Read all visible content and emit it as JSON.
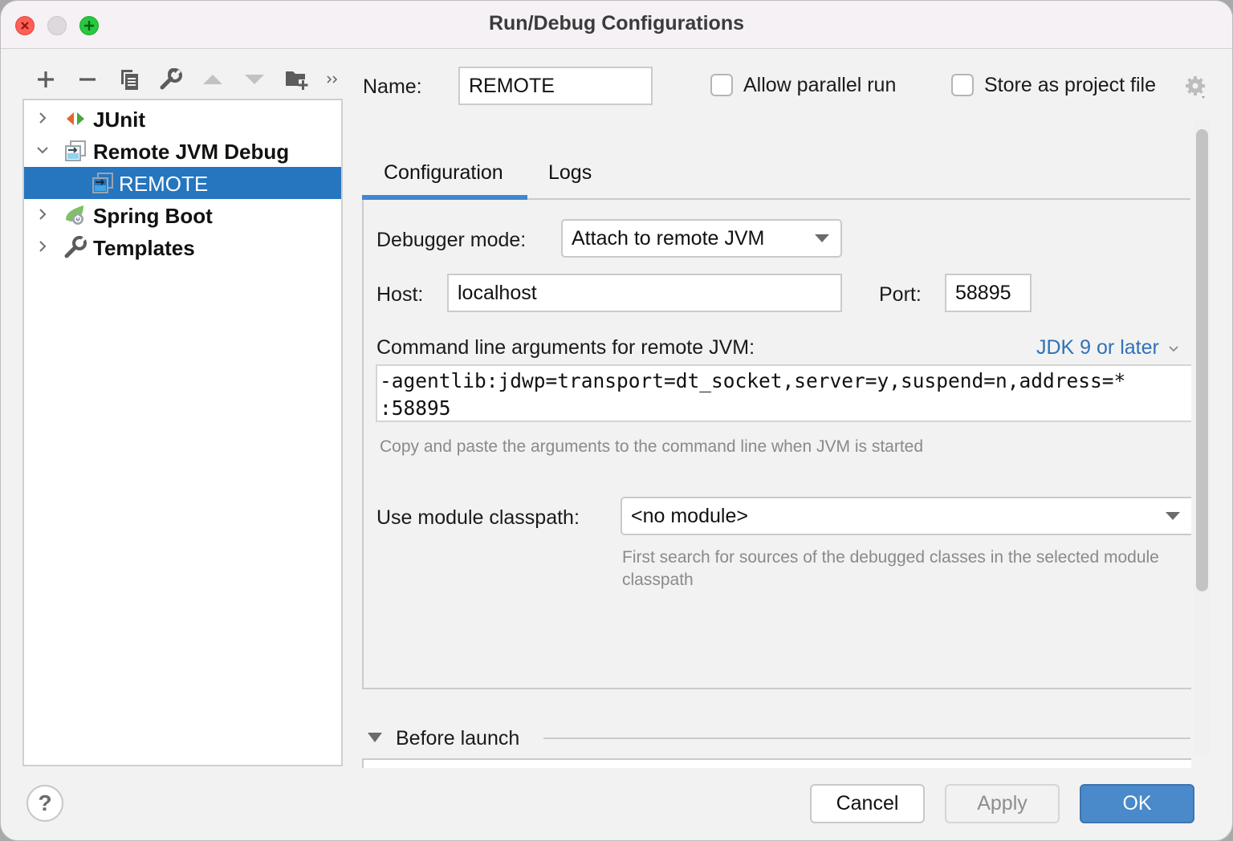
{
  "window": {
    "title": "Run/Debug Configurations"
  },
  "toolbar": {
    "buttons": [
      {
        "name": "add",
        "icon": "plus-icon"
      },
      {
        "name": "remove",
        "icon": "minus-icon"
      },
      {
        "name": "copy",
        "icon": "copy-icon"
      },
      {
        "name": "edit-templates",
        "icon": "wrench-icon"
      },
      {
        "name": "move-up",
        "icon": "triangle-up-icon"
      },
      {
        "name": "move-down",
        "icon": "triangle-down-icon"
      },
      {
        "name": "new-folder",
        "icon": "folder-add-icon"
      },
      {
        "name": "more",
        "icon": "double-chevron-right-icon",
        "label": "»"
      }
    ]
  },
  "tree": {
    "items": [
      {
        "label": "JUnit",
        "expanded": false,
        "icon": "junit-icon",
        "level": 0
      },
      {
        "label": "Remote JVM Debug",
        "expanded": true,
        "icon": "remote-debug-icon",
        "level": 0
      },
      {
        "label": "REMOTE",
        "selected": true,
        "icon": "remote-debug-icon",
        "level": 1
      },
      {
        "label": "Spring Boot",
        "expanded": false,
        "icon": "spring-boot-icon",
        "level": 0
      },
      {
        "label": "Templates",
        "expanded": false,
        "icon": "wrench-icon",
        "level": 0
      }
    ]
  },
  "form": {
    "name_label": "Name:",
    "name_value": "REMOTE",
    "allow_parallel_label": "Allow parallel run",
    "allow_parallel_checked": false,
    "store_project_label": "Store as project file",
    "store_project_checked": false,
    "tabs": [
      {
        "label": "Configuration",
        "active": true
      },
      {
        "label": "Logs",
        "active": false
      }
    ],
    "debugger_mode_label": "Debugger mode:",
    "debugger_mode_value": "Attach to remote JVM",
    "host_label": "Host:",
    "host_value": "localhost",
    "port_label": "Port:",
    "port_value": "58895",
    "cmdline_label": "Command line arguments for remote JVM:",
    "jdk_link": "JDK 9 or later",
    "cmdline_value": "-agentlib:jdwp=transport=dt_socket,server=y,suspend=n,address=*\n:58895",
    "cmdline_hint": "Copy and paste the arguments to the command line when JVM is started",
    "module_label": "Use module classpath:",
    "module_value": "<no module>",
    "module_hint": "First search for sources of the debugged classes in the selected module classpath",
    "before_launch_label": "Before launch"
  },
  "buttons": {
    "help": "?",
    "cancel": "Cancel",
    "apply": "Apply",
    "apply_enabled": false,
    "ok": "OK"
  },
  "colors": {
    "accent": "#2675bf",
    "ok_button": "#4a8acb",
    "link": "#2f72b8",
    "tab_underline": "#3f87d1"
  }
}
